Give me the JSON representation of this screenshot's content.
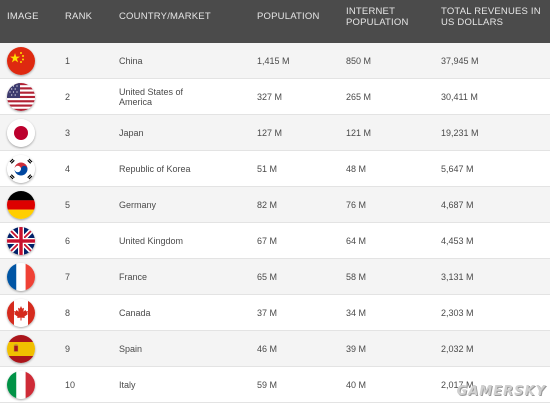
{
  "headers": {
    "image": "IMAGE",
    "rank": "RANK",
    "country": "COUNTRY/MARKET",
    "population": "POPULATION",
    "internet_line1": "INTERNET",
    "internet_line2": "POPULATION",
    "revenue_line1": "TOTAL REVENUES IN",
    "revenue_line2": "US DOLLARS"
  },
  "rows": [
    {
      "flag": "china-flag-icon",
      "rank": "1",
      "country_line1": "China",
      "country_line2": "",
      "population": "1,415 M",
      "internet": "850 M",
      "revenue": "37,945 M"
    },
    {
      "flag": "usa-flag-icon",
      "rank": "2",
      "country_line1": "United States of",
      "country_line2": "America",
      "population": "327 M",
      "internet": "265 M",
      "revenue": "30,411 M"
    },
    {
      "flag": "japan-flag-icon",
      "rank": "3",
      "country_line1": "Japan",
      "country_line2": "",
      "population": "127 M",
      "internet": "121 M",
      "revenue": "19,231 M"
    },
    {
      "flag": "korea-flag-icon",
      "rank": "4",
      "country_line1": "Republic of Korea",
      "country_line2": "",
      "population": "51 M",
      "internet": "48 M",
      "revenue": "5,647 M"
    },
    {
      "flag": "germany-flag-icon",
      "rank": "5",
      "country_line1": "Germany",
      "country_line2": "",
      "population": "82 M",
      "internet": "76 M",
      "revenue": "4,687 M"
    },
    {
      "flag": "uk-flag-icon",
      "rank": "6",
      "country_line1": "United Kingdom",
      "country_line2": "",
      "population": "67 M",
      "internet": "64 M",
      "revenue": "4,453 M"
    },
    {
      "flag": "france-flag-icon",
      "rank": "7",
      "country_line1": "France",
      "country_line2": "",
      "population": "65 M",
      "internet": "58 M",
      "revenue": "3,131 M"
    },
    {
      "flag": "canada-flag-icon",
      "rank": "8",
      "country_line1": "Canada",
      "country_line2": "",
      "population": "37 M",
      "internet": "34 M",
      "revenue": "2,303 M"
    },
    {
      "flag": "spain-flag-icon",
      "rank": "9",
      "country_line1": "Spain",
      "country_line2": "",
      "population": "46 M",
      "internet": "39 M",
      "revenue": "2,032 M"
    },
    {
      "flag": "italy-flag-icon",
      "rank": "10",
      "country_line1": "Italy",
      "country_line2": "",
      "population": "59 M",
      "internet": "40 M",
      "revenue": "2,017 M"
    }
  ],
  "watermark": "GAMERSKY",
  "colors": {
    "header_bg": "#4b4b4b",
    "header_text": "#e6e6e6",
    "row_alt": "#f4f4f4",
    "text": "#4a4a4a"
  }
}
